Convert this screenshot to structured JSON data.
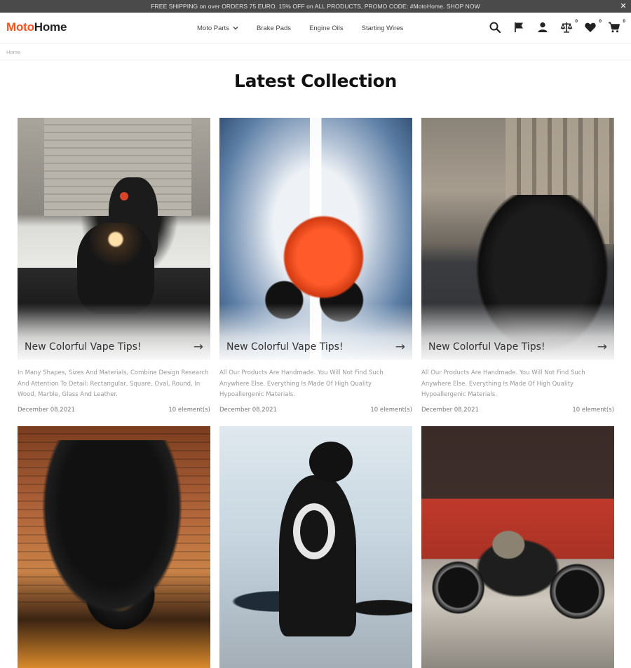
{
  "promo": {
    "text": "FREE SHIPPING on over ORDERS 75 EURO. 15% OFF on ALL PRODUCTS, PROMO CODE: #MotoHome. SHOP NOW",
    "close": "✕"
  },
  "header": {
    "logo_part1": "Moto",
    "logo_part2": "Home",
    "brand_color": "#f4511e",
    "nav": [
      {
        "label": "Moto Parts",
        "has_dropdown": true
      },
      {
        "label": "Brake Pads"
      },
      {
        "label": "Engine Oils"
      },
      {
        "label": "Starting Wires"
      }
    ],
    "icons": [
      {
        "name": "search-icon"
      },
      {
        "name": "flag-icon"
      },
      {
        "name": "user-icon"
      },
      {
        "name": "compare-icon",
        "count": "0"
      },
      {
        "name": "heart-icon",
        "count": "0"
      },
      {
        "name": "cart-icon",
        "count": "0"
      }
    ]
  },
  "breadcrumb": {
    "home": "Home"
  },
  "page": {
    "title": "Latest Collection"
  },
  "cards": [
    {
      "caption": "New Colorful Vape Tips!",
      "arrow": "→",
      "description": "In Many Shapes, Sizes And Materials, Combine Design Research And Attention To Detail: Rectangular, Square, Oval, Round, In Wood, Marble, Glass And Leather.",
      "date": "December 08.2021",
      "elements": "10 element(s)"
    },
    {
      "caption": "New Colorful Vape Tips!",
      "arrow": "→",
      "description": "All Our Products Are Handmade. You Will Not Find Such Anywhere Else. Everything Is Made Of High Quality Hypoallergenic Materials.",
      "date": "December 08.2021",
      "elements": "10 element(s)"
    },
    {
      "caption": "New Colorful Vape Tips!",
      "arrow": "→",
      "description": "All Our Products Are Handmade. You Will Not Find Such Anywhere Else. Everything Is Made Of High Quality Hypoallergenic Materials.",
      "date": "December 08.2021",
      "elements": "10 element(s)"
    },
    {
      "image": "black sport motorcycle in garage"
    },
    {
      "image": "rider in helmet with motorcycle"
    },
    {
      "image": "vintage motorcycle against red wall"
    }
  ]
}
